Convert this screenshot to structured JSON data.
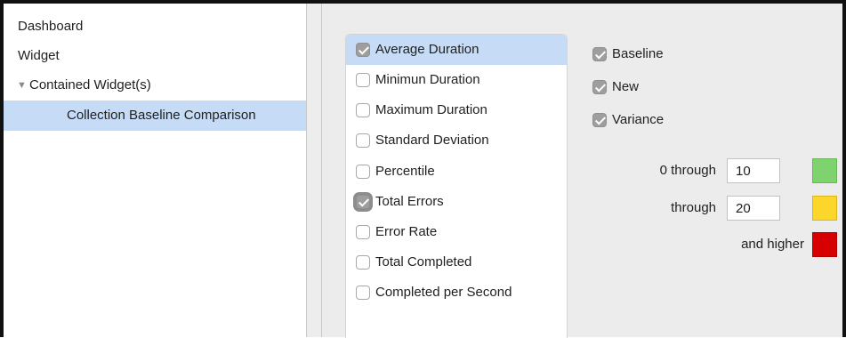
{
  "sidebar": {
    "items": [
      {
        "label": "Dashboard"
      },
      {
        "label": "Widget"
      },
      {
        "label": "Contained Widget(s)",
        "disclosure": "▼"
      },
      {
        "label": "Collection Baseline Comparison",
        "selected": true
      }
    ]
  },
  "metrics": [
    {
      "label": "Average Duration",
      "checked": true,
      "selected": true
    },
    {
      "label": "Minimun Duration",
      "checked": false
    },
    {
      "label": "Maximum Duration",
      "checked": false
    },
    {
      "label": "Standard Deviation",
      "checked": false
    },
    {
      "label": "Percentile",
      "checked": false
    },
    {
      "label": "Total Errors",
      "checked": true,
      "focused": true
    },
    {
      "label": "Error Rate",
      "checked": false
    },
    {
      "label": "Total Completed",
      "checked": false
    },
    {
      "label": "Completed per Second",
      "checked": false
    }
  ],
  "options": [
    {
      "label": "Baseline",
      "checked": true
    },
    {
      "label": "New",
      "checked": true
    },
    {
      "label": "Variance",
      "checked": true
    }
  ],
  "thresholds": [
    {
      "label": "0 through",
      "value": "10",
      "color": "#7ed36e"
    },
    {
      "label": "through",
      "value": "20",
      "color": "#fcd62a"
    },
    {
      "label": "and higher",
      "color": "#d60000"
    }
  ]
}
